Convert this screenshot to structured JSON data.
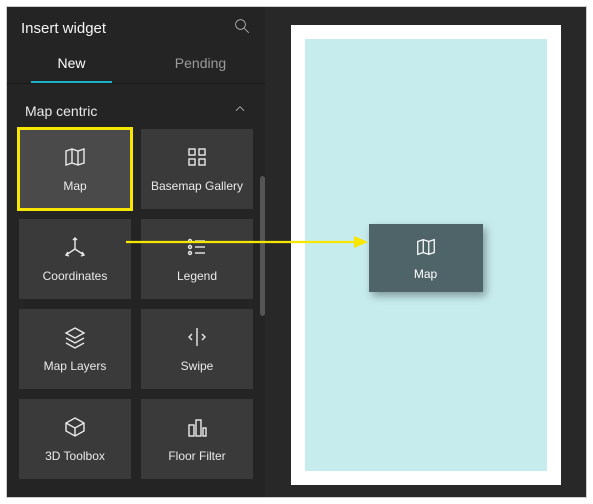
{
  "panel": {
    "title": "Insert widget",
    "tabs": {
      "new": "New",
      "pending": "Pending"
    },
    "section": "Map centric",
    "widgets": [
      {
        "label": "Map"
      },
      {
        "label": "Basemap Gallery"
      },
      {
        "label": "Coordinates"
      },
      {
        "label": "Legend"
      },
      {
        "label": "Map Layers"
      },
      {
        "label": "Swipe"
      },
      {
        "label": "3D Toolbox"
      },
      {
        "label": "Floor Filter"
      }
    ]
  },
  "canvas": {
    "ghost_label": "Map"
  },
  "colors": {
    "highlight": "#f7e600",
    "accent": "#1fb3c9"
  }
}
